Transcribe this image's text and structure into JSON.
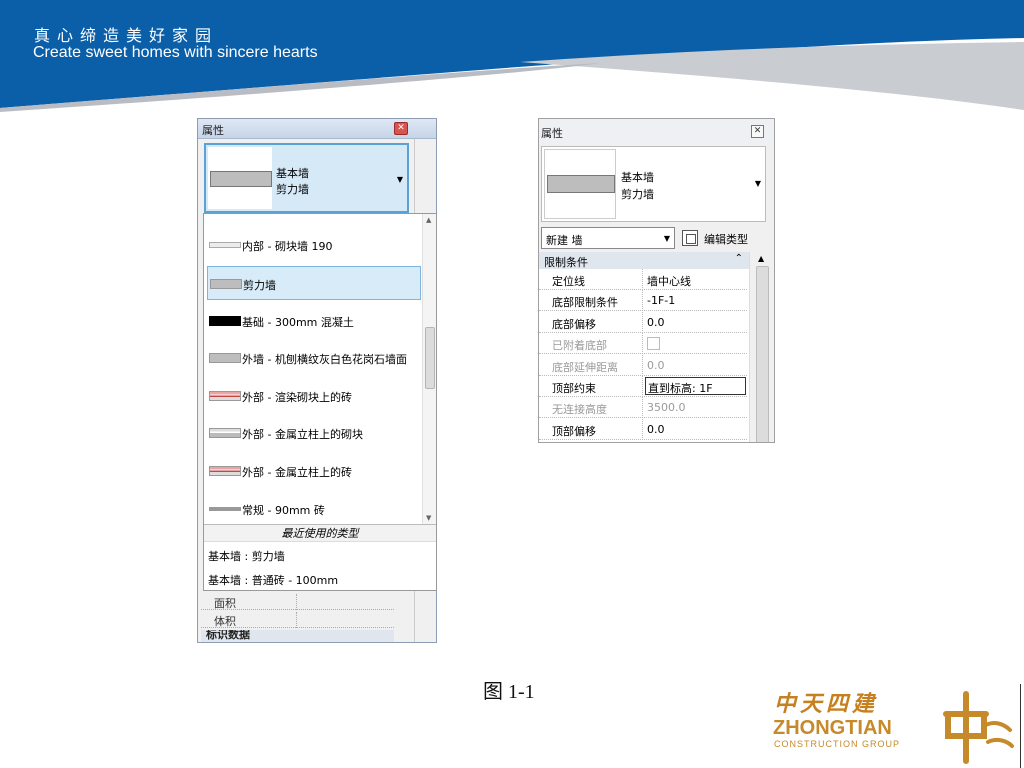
{
  "header": {
    "slogan_cn": "真心缔造美好家园",
    "slogan_en": "Create sweet homes with sincere hearts",
    "colors": {
      "band": "#0a5fa8",
      "swoosh": "#c9ccd1"
    }
  },
  "left_panel": {
    "title": "属性",
    "close_icon": "close-icon",
    "type_selector": {
      "line1": "基本墙",
      "line2": "剪力墙"
    },
    "dropdown_items": [
      {
        "label": "内部 - 砌块墙 190",
        "swatch": "light-gray"
      },
      {
        "label": "剪力墙",
        "swatch": "gray",
        "selected": true
      },
      {
        "label": "基础 - 300mm 混凝土",
        "swatch": "black"
      },
      {
        "label": "外墙 - 机刨横纹灰白色花岗石墙面",
        "swatch": "gray"
      },
      {
        "label": "外部 - 渲染砌块上的砖",
        "swatch": "red-stripe"
      },
      {
        "label": "外部 - 金属立柱上的砌块",
        "swatch": "gray-stripe"
      },
      {
        "label": "外部 - 金属立柱上的砖",
        "swatch": "red-stripe"
      },
      {
        "label": "常规 - 90mm 砖",
        "swatch": "thin-gray"
      }
    ],
    "recent_header": "最近使用的类型",
    "recent_items": [
      "基本墙 : 剪力墙",
      "基本墙 : 普通砖 - 100mm"
    ],
    "below_rows": [
      {
        "key": "面积"
      },
      {
        "key": "体积"
      }
    ],
    "below_section": "标识数据"
  },
  "right_panel": {
    "title": "属性",
    "type_selector": {
      "line1": "基本墙",
      "line2": "剪力墙"
    },
    "instance_filter": "新建 墙",
    "edit_type_label": "编辑类型",
    "section": "限制条件",
    "rows": [
      {
        "key": "定位线",
        "value": "墙中心线"
      },
      {
        "key": "底部限制条件",
        "value": "-1F-1"
      },
      {
        "key": "底部偏移",
        "value": "0.0"
      },
      {
        "key": "已附着底部",
        "value": "",
        "disabled": true,
        "checkbox": true
      },
      {
        "key": "底部延伸距离",
        "value": "0.0",
        "disabled": true
      },
      {
        "key": "顶部约束",
        "value": "直到标高: 1F",
        "editing": true
      },
      {
        "key": "无连接高度",
        "value": "3500.0",
        "disabled": true
      },
      {
        "key": "顶部偏移",
        "value": "0.0"
      }
    ]
  },
  "caption": "图 1-1",
  "logo": {
    "cn": "中天四建",
    "en": "ZHONGTIAN",
    "sub": "CONSTRUCTION GROUP",
    "color": "#c68a2a"
  }
}
